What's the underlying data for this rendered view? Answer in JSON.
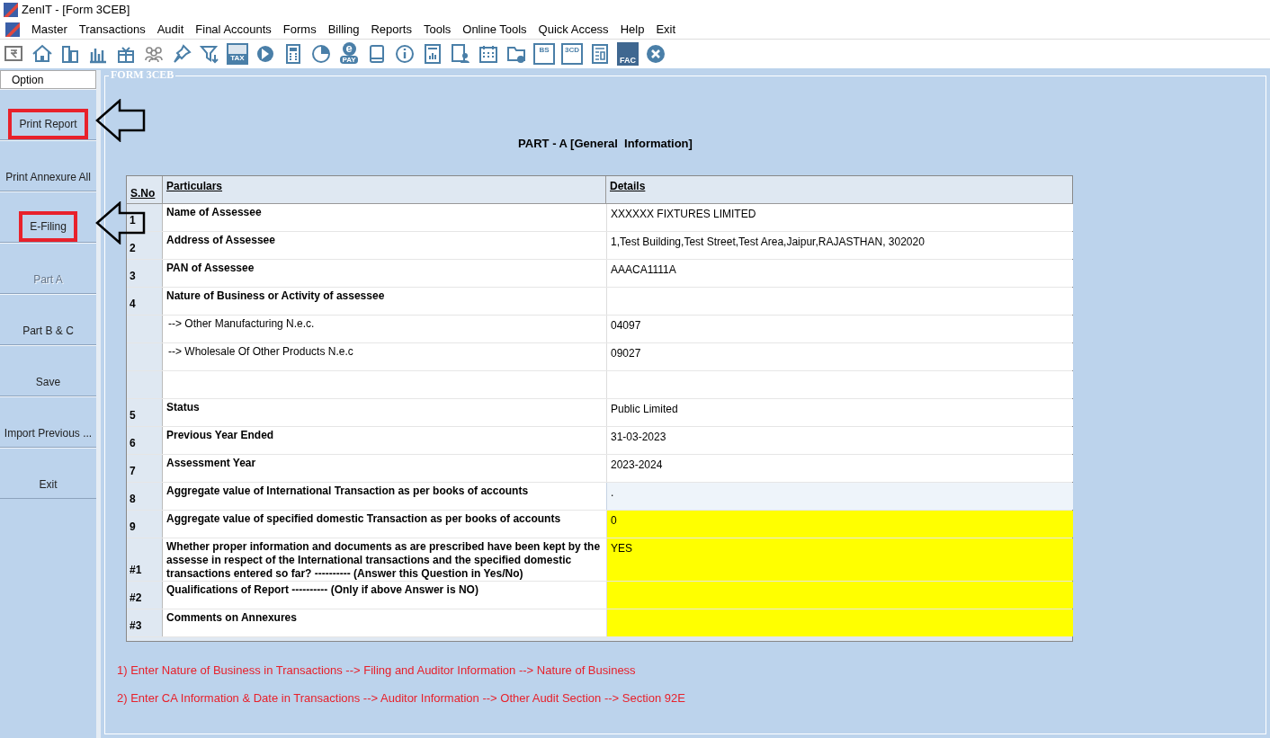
{
  "window": {
    "title": "ZenIT - [Form 3CEB]"
  },
  "menu": [
    "Master",
    "Transactions",
    "Audit",
    "Final Accounts",
    "Forms",
    "Billing",
    "Reports",
    "Tools",
    "Online Tools",
    "Quick Access",
    "Help",
    "Exit"
  ],
  "toolbar": [
    {
      "kind": "rupee"
    },
    {
      "kind": "home"
    },
    {
      "kind": "building"
    },
    {
      "kind": "bars"
    },
    {
      "kind": "gift"
    },
    {
      "kind": "people"
    },
    {
      "kind": "pin"
    },
    {
      "kind": "filter"
    },
    {
      "kind": "badge",
      "text": "TAX"
    },
    {
      "kind": "disc"
    },
    {
      "kind": "calculator"
    },
    {
      "kind": "pie"
    },
    {
      "kind": "epay",
      "text": "e",
      "text2": "PAY"
    },
    {
      "kind": "book"
    },
    {
      "kind": "info"
    },
    {
      "kind": "report"
    },
    {
      "kind": "user"
    },
    {
      "kind": "calendar"
    },
    {
      "kind": "folder"
    },
    {
      "kind": "box",
      "text": "BS"
    },
    {
      "kind": "box",
      "text": "3CD"
    },
    {
      "kind": "sheet"
    },
    {
      "kind": "fac",
      "text": "FAC"
    },
    {
      "kind": "close"
    }
  ],
  "sidebar": {
    "header": "Option",
    "buttons": [
      {
        "label": "Print Report",
        "disabled": false,
        "annotated": true
      },
      {
        "label": "Print Annexure All",
        "disabled": false,
        "annotated": false
      },
      {
        "label": "E-Filing",
        "disabled": false,
        "annotated": true
      },
      {
        "label": "Part A",
        "disabled": true,
        "annotated": false
      },
      {
        "label": "Part B & C",
        "disabled": false,
        "annotated": false
      },
      {
        "label": "Save",
        "disabled": false,
        "annotated": false
      },
      {
        "label": "Import Previous ...",
        "disabled": false,
        "annotated": false
      },
      {
        "label": "Exit",
        "disabled": false,
        "annotated": false
      }
    ]
  },
  "panel": {
    "legend": "FORM 3CEB",
    "heading": "PART - A [General  Information]",
    "table": {
      "columns": [
        "S.No",
        "Particulars",
        "Details"
      ],
      "rows": [
        {
          "sno": "1",
          "particulars": "Name of Assessee",
          "details": "XXXXXX FIXTURES LIMITED",
          "kind": "item",
          "highlighted": false,
          "readonly": false
        },
        {
          "sno": "2",
          "particulars": "Address of Assessee",
          "details": "1,Test Building,Test Street,Test Area,Jaipur,RAJASTHAN, 302020",
          "kind": "item",
          "highlighted": false,
          "readonly": false
        },
        {
          "sno": "3",
          "particulars": "PAN of Assessee",
          "details": "AAACA1111A",
          "kind": "item",
          "highlighted": false,
          "readonly": false
        },
        {
          "sno": "4",
          "particulars": "Nature of Business or Activity of assessee",
          "kind": "item",
          "highlighted": false,
          "readonly": false
        },
        {
          "particulars": "--> Other Manufacturing N.e.c.",
          "details": "04097",
          "kind": "sub",
          "highlighted": false,
          "readonly": false
        },
        {
          "particulars": "--> Wholesale Of Other Products N.e.c",
          "details": "09027",
          "kind": "sub",
          "highlighted": false,
          "readonly": false
        },
        {
          "kind": "blank",
          "highlighted": false,
          "readonly": false
        },
        {
          "sno": "5",
          "particulars": "Status",
          "details": "Public Limited",
          "kind": "item",
          "highlighted": false,
          "readonly": false
        },
        {
          "sno": "6",
          "particulars": "Previous Year Ended",
          "details": "31-03-2023",
          "kind": "item",
          "highlighted": false,
          "readonly": false
        },
        {
          "sno": "7",
          "particulars": "Assessment Year",
          "details": "2023-2024",
          "kind": "item",
          "highlighted": false,
          "readonly": false
        },
        {
          "sno": "8",
          "particulars": "Aggregate value of International Transaction as per books of accounts",
          "details": ".",
          "kind": "item",
          "highlighted": false,
          "readonly": true
        },
        {
          "sno": "9",
          "particulars": "Aggregate value of specified domestic Transaction as per books of accounts",
          "details": "0",
          "kind": "item",
          "highlighted": true,
          "readonly": false
        },
        {
          "sno": "#1",
          "particulars": "Whether proper information and documents as are prescribed have been kept by the assesse in respect of the International transactions and the specified domestic transactions entered so far? ---------- (Answer this Question in Yes/No)",
          "details": "YES",
          "kind": "tall",
          "highlighted": true,
          "readonly": false
        },
        {
          "sno": "#2",
          "particulars": "Qualifications of Report ---------- (Only if above Answer is NO)",
          "kind": "item",
          "highlighted": true,
          "readonly": false
        },
        {
          "sno": "#3",
          "particulars": "Comments on Annexures",
          "kind": "item",
          "highlighted": true,
          "readonly": false
        }
      ]
    },
    "notes": [
      "1) Enter Nature of Business in Transactions --> Filing and Auditor Information --> Nature of Business",
      "2) Enter CA Information & Date in Transactions --> Auditor Information --> Other Audit Section --> Section 92E"
    ]
  }
}
